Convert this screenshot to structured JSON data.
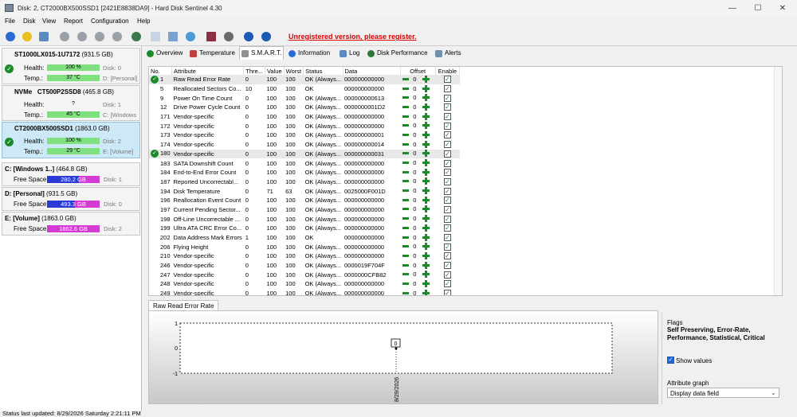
{
  "window": {
    "title": "Disk: 2, CT2000BX500SSD1 [2421E8838DA9]  -  Hard Disk Sentinel 4.30",
    "minimize": "—",
    "maximize": "☐",
    "close": "✕"
  },
  "menu": [
    "File",
    "Disk",
    "View",
    "Report",
    "Configuration",
    "Help"
  ],
  "toolbar": {
    "icons": [
      "refresh-icon",
      "warning-icon",
      "display-icon",
      "satellite-icon",
      "satellite-icon",
      "satellite-icon",
      "satellite-icon",
      "globe-icon",
      "document-icon",
      "copy-icon",
      "cloud-icon",
      "report-icon",
      "gear-icon",
      "help-icon",
      "info-icon"
    ],
    "unregistered": "Unregistered version, please register."
  },
  "disks": [
    {
      "name": "ST1000LX015-1U7172",
      "size": "(931.5 GB)",
      "health_label": "Health:",
      "health": "100 %",
      "temp_label": "Temp.:",
      "temp": "37 °C",
      "side1": "Disk: 0",
      "side2": "D: [Personal]",
      "prefix": ""
    },
    {
      "name": "CT500P2SSD8",
      "size": "(465.8 GB)",
      "health_label": "Health:",
      "health": "?",
      "temp_label": "Temp.:",
      "temp": "45 °C",
      "side1": "Disk: 1",
      "side2": "C: [Windows",
      "prefix": "NVMe"
    },
    {
      "name": "CT2000BX500SSD1",
      "size": "(1863.0 GB)",
      "health_label": "Health:",
      "health": "100 %",
      "temp_label": "Temp.:",
      "temp": "29 °C",
      "side1": "Disk: 2",
      "side2": "E: [Volume]",
      "prefix": ""
    }
  ],
  "volumes": [
    {
      "name": "C: [Windows 1..]",
      "size": "(464.8 GB)",
      "label": "Free Space",
      "free": "280.2 GB",
      "free_fraction": 0.6,
      "disk": "Disk: 1"
    },
    {
      "name": "D: [Personal]",
      "size": "(931.5 GB)",
      "label": "Free Space",
      "free": "493.3 GB",
      "free_fraction": 0.53,
      "disk": "Disk: 0"
    },
    {
      "name": "E: [Volume]",
      "size": "(1863.0 GB)",
      "label": "Free Space",
      "free": "1862.6 GB",
      "free_fraction": 0.0,
      "disk": "Disk: 2"
    }
  ],
  "tabs": [
    "Overview",
    "Temperature",
    "S.M.A.R.T.",
    "Information",
    "Log",
    "Disk Performance",
    "Alerts"
  ],
  "smart": {
    "headers": [
      "No.",
      "Attribute",
      "Thre...",
      "Value",
      "Worst",
      "Status",
      "Data",
      "Offset",
      "Enable"
    ],
    "rows": [
      [
        "1",
        "Raw Read Error Rate",
        "0",
        "100",
        "100",
        "OK (Always...",
        "000000000000"
      ],
      [
        "5",
        "Reallocated Sectors Co...",
        "10",
        "100",
        "100",
        "OK",
        "000000000000"
      ],
      [
        "9",
        "Power On Time Count",
        "0",
        "100",
        "100",
        "OK (Always...",
        "000000000613"
      ],
      [
        "12",
        "Drive Power Cycle Count",
        "0",
        "100",
        "100",
        "OK (Always...",
        "0000000001D2"
      ],
      [
        "171",
        "Vendor-specific",
        "0",
        "100",
        "100",
        "OK (Always...",
        "000000000000"
      ],
      [
        "172",
        "Vendor-specific",
        "0",
        "100",
        "100",
        "OK (Always...",
        "000000000000"
      ],
      [
        "173",
        "Vendor-specific",
        "0",
        "100",
        "100",
        "OK (Always...",
        "000000000001"
      ],
      [
        "174",
        "Vendor-specific",
        "0",
        "100",
        "100",
        "OK (Always...",
        "000000000014"
      ],
      [
        "180",
        "Vendor-specific",
        "0",
        "100",
        "100",
        "OK (Always...",
        "000000000031"
      ],
      [
        "183",
        "SATA Downshift Count",
        "0",
        "100",
        "100",
        "OK (Always...",
        "000000000000"
      ],
      [
        "184",
        "End-to-End Error Count",
        "0",
        "100",
        "100",
        "OK (Always...",
        "000000000000"
      ],
      [
        "187",
        "Reported Uncorrectabl...",
        "0",
        "100",
        "100",
        "OK (Always...",
        "000000000000"
      ],
      [
        "194",
        "Disk Temperature",
        "0",
        "71",
        "63",
        "OK (Always...",
        "0025000F001D"
      ],
      [
        "196",
        "Reallocation Event Count",
        "0",
        "100",
        "100",
        "OK (Always...",
        "000000000000"
      ],
      [
        "197",
        "Current Pending Sector...",
        "0",
        "100",
        "100",
        "OK (Always...",
        "000000000000"
      ],
      [
        "198",
        "Off-Line Uncorrectable ...",
        "0",
        "100",
        "100",
        "OK (Always...",
        "000000000000"
      ],
      [
        "199",
        "Ultra ATA CRC Error Co...",
        "0",
        "100",
        "100",
        "OK (Always...",
        "000000000000"
      ],
      [
        "202",
        "Data Address Mark Errors",
        "1",
        "100",
        "100",
        "OK",
        "000000000000"
      ],
      [
        "206",
        "Flying Height",
        "0",
        "100",
        "100",
        "OK (Always...",
        "000000000000"
      ],
      [
        "210",
        "Vendor-specific",
        "0",
        "100",
        "100",
        "OK (Always...",
        "000000000000"
      ],
      [
        "246",
        "Vendor-specific",
        "0",
        "100",
        "100",
        "OK (Always...",
        "0000019F704F"
      ],
      [
        "247",
        "Vendor-specific",
        "0",
        "100",
        "100",
        "OK (Always...",
        "0000000CFB82"
      ],
      [
        "248",
        "Vendor-specific",
        "0",
        "100",
        "100",
        "OK (Always...",
        "000000000000"
      ],
      [
        "249",
        "Vendor-specific",
        "0",
        "100",
        "100",
        "OK (Always...",
        "000000000000"
      ]
    ],
    "offset_value": "0",
    "icon_rows": [
      0,
      8
    ],
    "highlight_rows": [
      0,
      8
    ]
  },
  "graph": {
    "tab": "Raw Read Error Rate",
    "y_ticks": [
      "1",
      "0",
      "-1"
    ],
    "point_label": "0",
    "x_label": "8/29/2026"
  },
  "flags": {
    "title": "Flags",
    "value": "Self Preserving, Error-Rate, Performance, Statistical, Critical",
    "show_values": "Show values",
    "attr_graph": "Attribute graph",
    "select": "Display data field"
  },
  "status": "Status last updated: 8/29/2026 Saturday 2:21:11 PM"
}
